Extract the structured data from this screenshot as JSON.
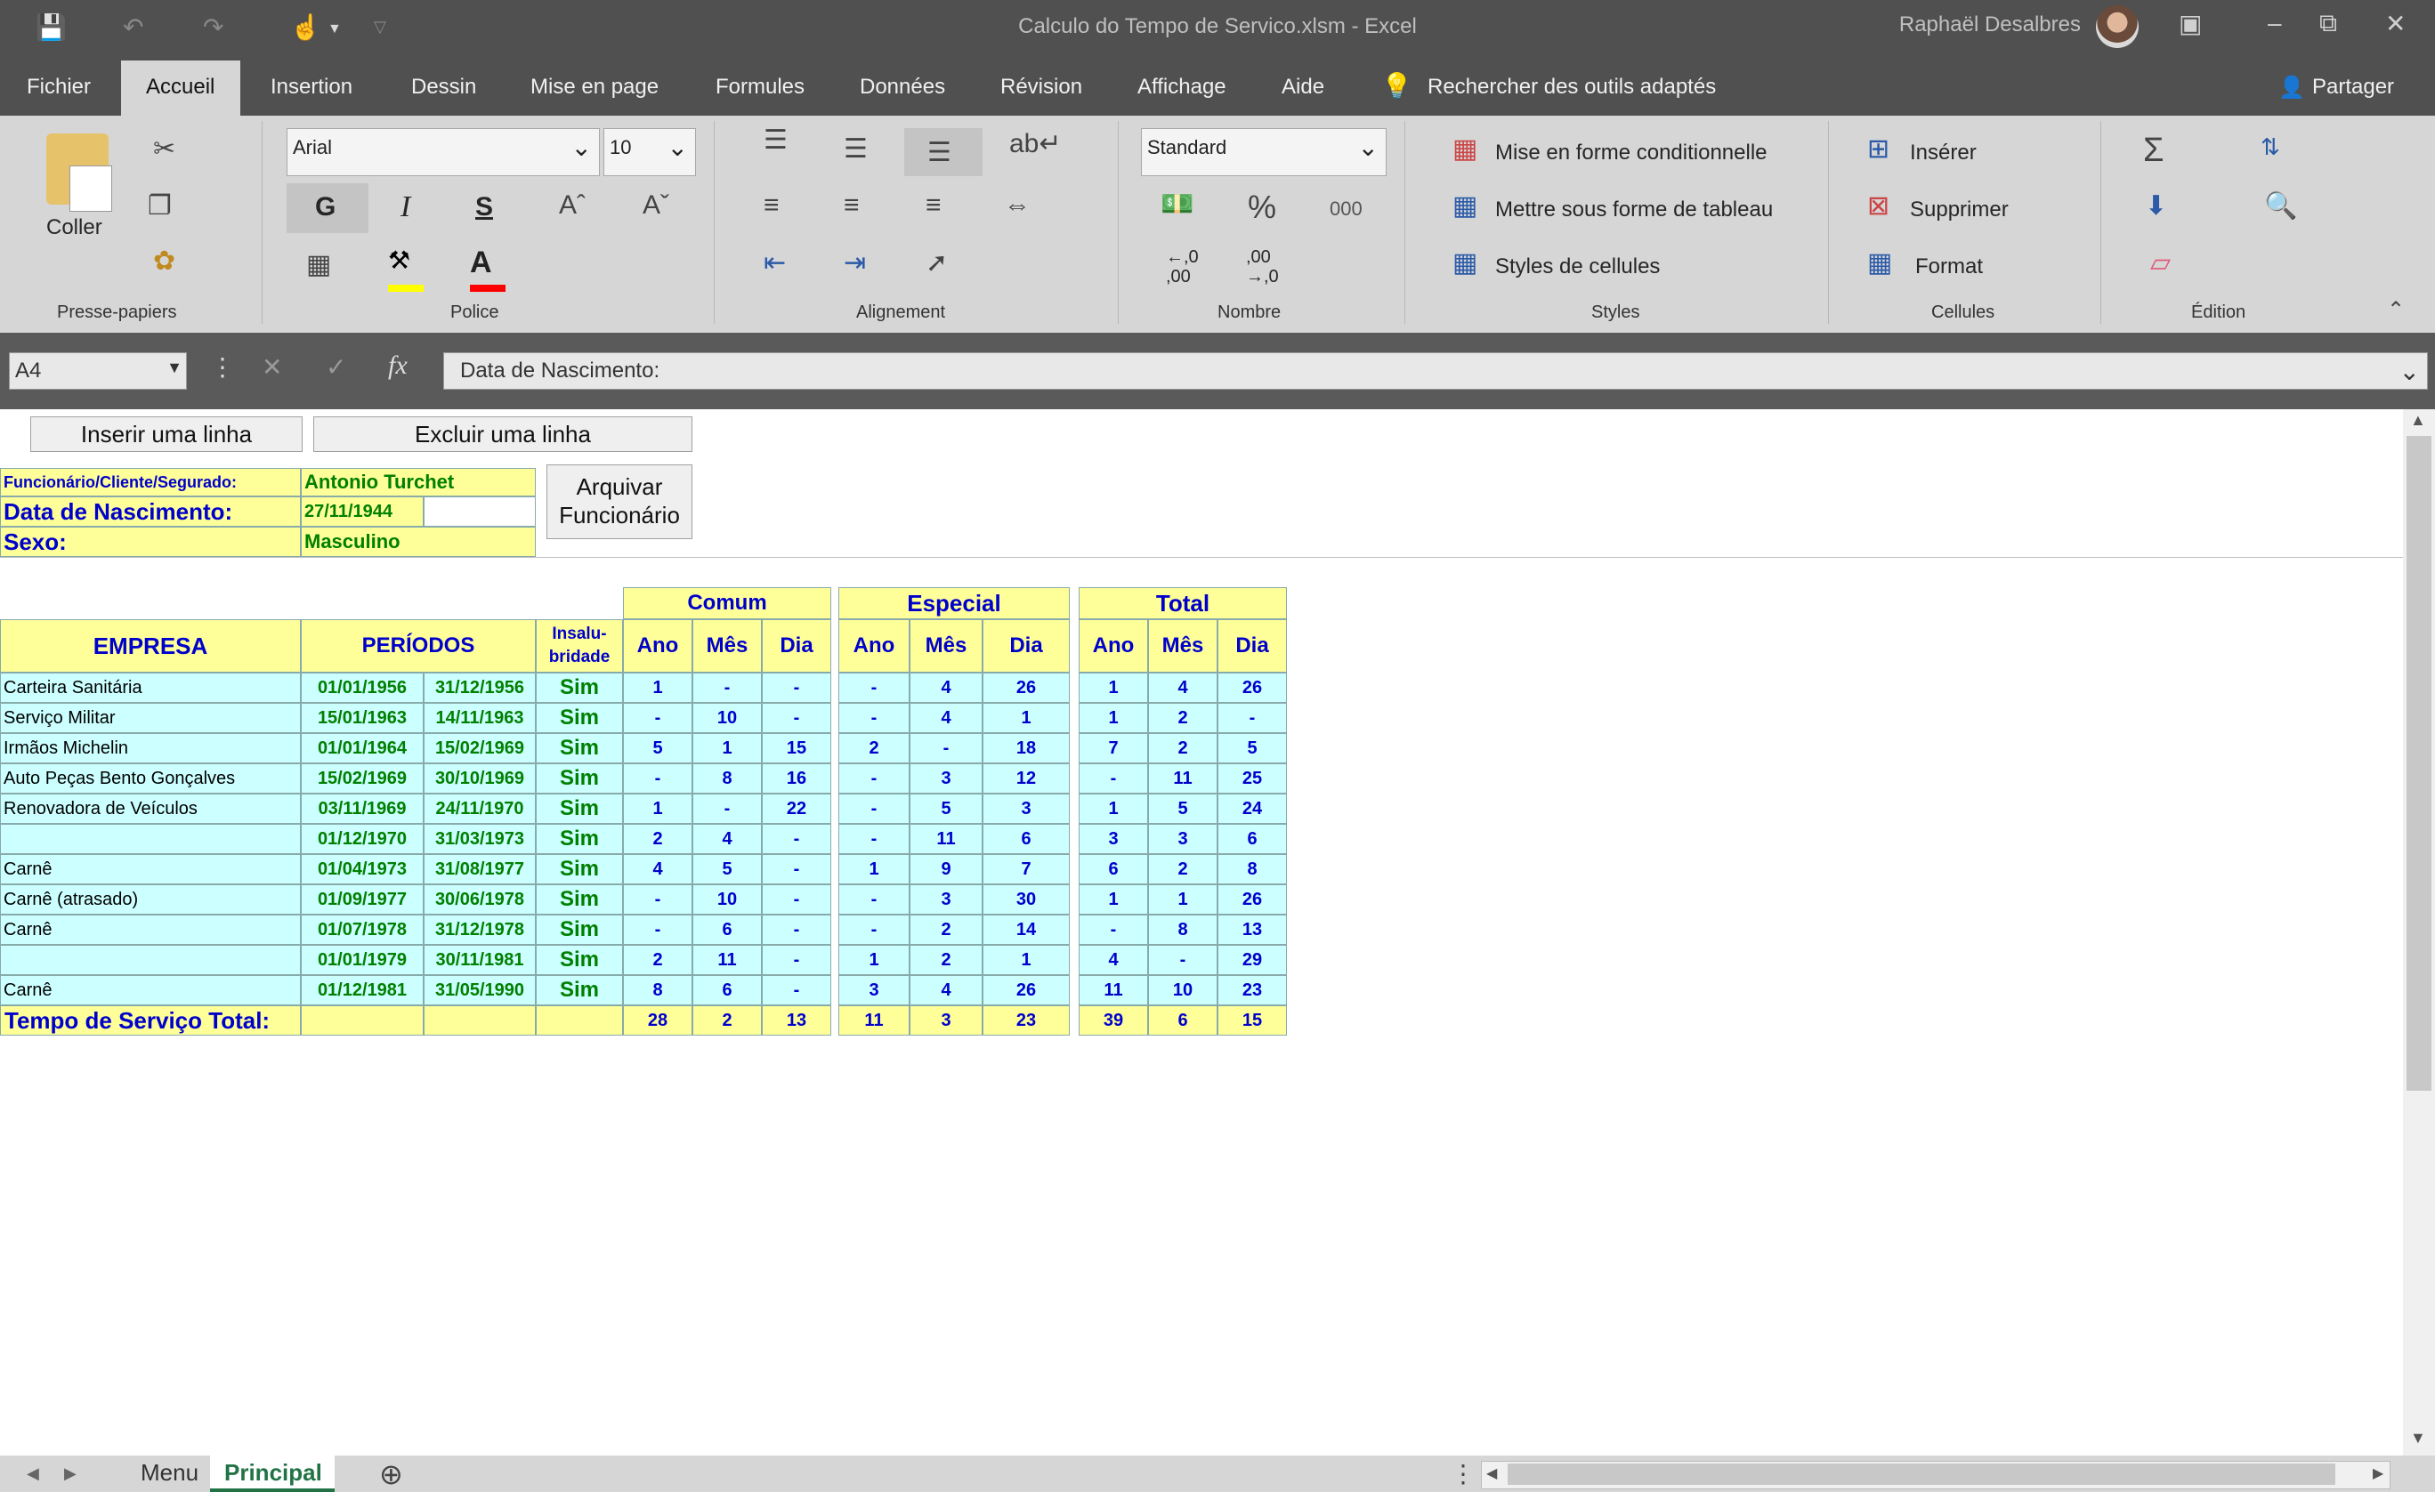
{
  "window": {
    "title": "Calculo do Tempo de Servico.xlsm  -  Excel",
    "user": "Raphaël Desalbres"
  },
  "menu": {
    "tabs": [
      "Fichier",
      "Accueil",
      "Insertion",
      "Dessin",
      "Mise en page",
      "Formules",
      "Données",
      "Révision",
      "Affichage",
      "Aide"
    ],
    "active_tab": "Accueil",
    "search": "Rechercher des outils adaptés",
    "share": "Partager"
  },
  "ribbon": {
    "clipboard": {
      "paste": "Coller",
      "label": "Presse-papiers"
    },
    "font": {
      "name": "Arial",
      "size": "10",
      "bold": "G",
      "italic": "I",
      "underline": "S",
      "label": "Police"
    },
    "alignment": {
      "label": "Alignement"
    },
    "number": {
      "format": "Standard",
      "percent": "%",
      "thousands": "000",
      "inc": "←,0\n,00",
      "dec": ",00\n→,0",
      "label": "Nombre"
    },
    "styles": {
      "conditional": "Mise en forme conditionnelle",
      "table": "Mettre sous forme de tableau",
      "cell_styles": "Styles de cellules",
      "label": "Styles"
    },
    "cells": {
      "insert": "Insérer",
      "delete": "Supprimer",
      "format": "Format",
      "label": "Cellules"
    },
    "editing": {
      "label": "Édition"
    }
  },
  "formula_bar": {
    "name_box": "A4",
    "formula": "Data de Nascimento:"
  },
  "sheet": {
    "buttons": {
      "insert_row": "Inserir uma linha",
      "delete_row": "Excluir uma linha",
      "archive": "Arquivar\nFuncionário"
    },
    "info": {
      "client_label": "Funcionário/Cliente/Segurado:",
      "client_value": "Antonio Turchet",
      "birth_label": "Data de Nascimento:",
      "birth_value": "27/11/1944",
      "sex_label": "Sexo:",
      "sex_value": "Masculino"
    },
    "headers": {
      "empresa": "EMPRESA",
      "periodos": "PERÍODOS",
      "insalubridade": "Insalu-\nbridade",
      "comum": "Comum",
      "especial": "Especial",
      "total": "Total",
      "ano": "Ano",
      "mes": "Mês",
      "dia": "Dia"
    },
    "rows": [
      {
        "empresa": "Carteira Sanitária",
        "start": "01/01/1956",
        "end": "31/12/1956",
        "ins": "Sim",
        "c": [
          "1",
          "-",
          "-"
        ],
        "e": [
          "-",
          "4",
          "26"
        ],
        "t": [
          "1",
          "4",
          "26"
        ]
      },
      {
        "empresa": "Serviço Militar",
        "start": "15/01/1963",
        "end": "14/11/1963",
        "ins": "Sim",
        "c": [
          "-",
          "10",
          "-"
        ],
        "e": [
          "-",
          "4",
          "1"
        ],
        "t": [
          "1",
          "2",
          "-"
        ]
      },
      {
        "empresa": "Irmãos Michelin",
        "start": "01/01/1964",
        "end": "15/02/1969",
        "ins": "Sim",
        "c": [
          "5",
          "1",
          "15"
        ],
        "e": [
          "2",
          "-",
          "18"
        ],
        "t": [
          "7",
          "2",
          "5"
        ]
      },
      {
        "empresa": "Auto Peças Bento Gonçalves",
        "start": "15/02/1969",
        "end": "30/10/1969",
        "ins": "Sim",
        "c": [
          "-",
          "8",
          "16"
        ],
        "e": [
          "-",
          "3",
          "12"
        ],
        "t": [
          "-",
          "11",
          "25"
        ]
      },
      {
        "empresa": "Renovadora de Veículos",
        "start": "03/11/1969",
        "end": "24/11/1970",
        "ins": "Sim",
        "c": [
          "1",
          "-",
          "22"
        ],
        "e": [
          "-",
          "5",
          "3"
        ],
        "t": [
          "1",
          "5",
          "24"
        ]
      },
      {
        "empresa": "",
        "start": "01/12/1970",
        "end": "31/03/1973",
        "ins": "Sim",
        "c": [
          "2",
          "4",
          "-"
        ],
        "e": [
          "-",
          "11",
          "6"
        ],
        "t": [
          "3",
          "3",
          "6"
        ]
      },
      {
        "empresa": "Carnê",
        "start": "01/04/1973",
        "end": "31/08/1977",
        "ins": "Sim",
        "c": [
          "4",
          "5",
          "-"
        ],
        "e": [
          "1",
          "9",
          "7"
        ],
        "t": [
          "6",
          "2",
          "8"
        ]
      },
      {
        "empresa": "Carnê (atrasado)",
        "start": "01/09/1977",
        "end": "30/06/1978",
        "ins": "Sim",
        "c": [
          "-",
          "10",
          "-"
        ],
        "e": [
          "-",
          "3",
          "30"
        ],
        "t": [
          "1",
          "1",
          "26"
        ]
      },
      {
        "empresa": "Carnê",
        "start": "01/07/1978",
        "end": "31/12/1978",
        "ins": "Sim",
        "c": [
          "-",
          "6",
          "-"
        ],
        "e": [
          "-",
          "2",
          "14"
        ],
        "t": [
          "-",
          "8",
          "13"
        ]
      },
      {
        "empresa": "",
        "start": "01/01/1979",
        "end": "30/11/1981",
        "ins": "Sim",
        "c": [
          "2",
          "11",
          "-"
        ],
        "e": [
          "1",
          "2",
          "1"
        ],
        "t": [
          "4",
          "-",
          "29"
        ]
      },
      {
        "empresa": "Carnê",
        "start": "01/12/1981",
        "end": "31/05/1990",
        "ins": "Sim",
        "c": [
          "8",
          "6",
          "-"
        ],
        "e": [
          "3",
          "4",
          "26"
        ],
        "t": [
          "11",
          "10",
          "23"
        ]
      }
    ],
    "total": {
      "label": "Tempo de Serviço Total:",
      "c": [
        "28",
        "2",
        "13"
      ],
      "e": [
        "11",
        "3",
        "23"
      ],
      "t": [
        "39",
        "6",
        "15"
      ]
    }
  },
  "sheet_tabs": [
    "Menu",
    "Principal"
  ],
  "active_sheet": "Principal"
}
